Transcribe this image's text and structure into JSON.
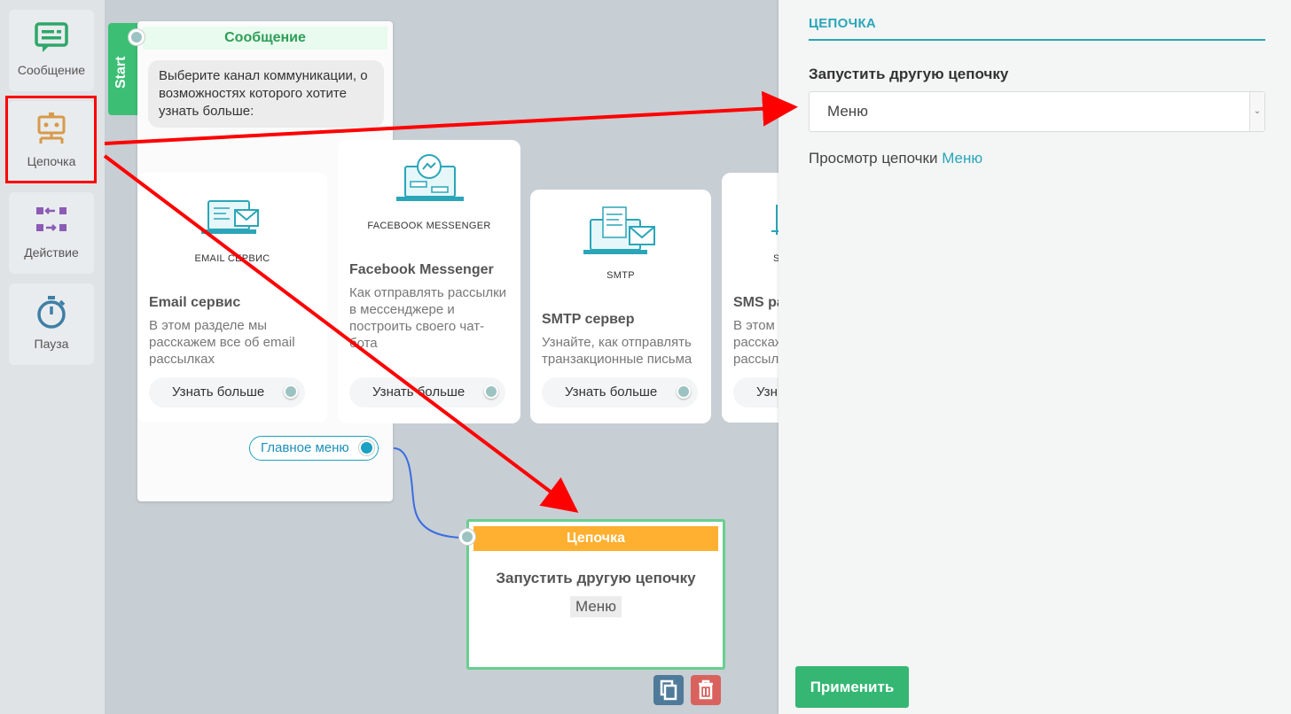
{
  "sidebar": {
    "items": [
      {
        "label": "Сообщение",
        "icon": "message-icon"
      },
      {
        "label": "Цепочка",
        "icon": "chain-icon"
      },
      {
        "label": "Действие",
        "icon": "action-icon"
      },
      {
        "label": "Пауза",
        "icon": "stopwatch-icon"
      }
    ]
  },
  "canvas": {
    "start_label": "Start",
    "message_node": {
      "title": "Сообщение",
      "text": "Выберите канал коммуникации, о возможностях которого хотите узнать больше:",
      "main_menu_label": "Главное меню"
    },
    "cards": [
      {
        "caption": "EMAIL СЕРВИС",
        "title": "Email сервис",
        "desc": "В этом разделе мы расскажем все об email рассылках",
        "button": "Узнать больше"
      },
      {
        "caption": "FACEBOOK MESSENGER",
        "title": "Facebook Messenger",
        "desc": "Как отправлять рассылки в мессенджере и построить своего чат-бота",
        "button": "Узнать больше"
      },
      {
        "caption": "SMTP",
        "title": "SMTP сервер",
        "desc": "Узнайте, как отправлять транзакционные письма",
        "button": "Узнать больше"
      },
      {
        "caption": "S",
        "title": "SMS ра",
        "desc": "В этом расскаж рассыл",
        "button": "Узн"
      }
    ],
    "chain_node": {
      "title": "Цепочка",
      "heading": "Запустить другую цепочку",
      "value": "Меню"
    }
  },
  "panel": {
    "title": "ЦЕПОЧКА",
    "field_label": "Запустить другую цепочку",
    "select_value": "Меню",
    "view_prefix": "Просмотр цепочки",
    "view_link": "Меню",
    "apply_label": "Применить"
  },
  "colors": {
    "accent": "#2aa6b8",
    "green": "#35b773",
    "orange": "#ffb030",
    "annotation": "#ff0000"
  }
}
